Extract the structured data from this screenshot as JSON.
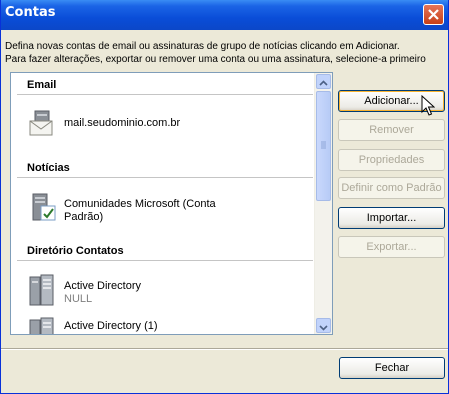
{
  "window": {
    "title": "Contas"
  },
  "description": {
    "line1": "Defina novas contas de email ou assinaturas de grupo de notícias clicando em Adicionar.",
    "line2": "Para fazer alterações, exportar ou remover uma conta ou uma assinatura, selecione-a primeiro"
  },
  "accounts": {
    "sections": [
      {
        "header": "Email",
        "entries": [
          {
            "name": "mail.seudominio.com.br",
            "icon": "mail-account-icon"
          }
        ]
      },
      {
        "header": "Notícias",
        "entries": [
          {
            "name": "Comunidades Microsoft (Conta",
            "name2": "Padrão)",
            "icon": "news-account-icon"
          }
        ]
      },
      {
        "header": "Diretório Contatos",
        "entries": [
          {
            "name": "Active Directory",
            "sub": "NULL",
            "icon": "directory-server-icon"
          },
          {
            "name": "Active Directory (1)",
            "icon": "directory-server-icon"
          }
        ]
      }
    ]
  },
  "buttons": {
    "add": "Adicionar...",
    "remove": "Remover",
    "properties": "Propriedades",
    "set_default": "Definir como Padrão",
    "import": "Importar...",
    "export": "Exportar...",
    "close": "Fechar"
  },
  "colors": {
    "title_bar": "#0a4dd8",
    "dialog_bg": "#ece9d8",
    "close_red": "#c74018"
  }
}
